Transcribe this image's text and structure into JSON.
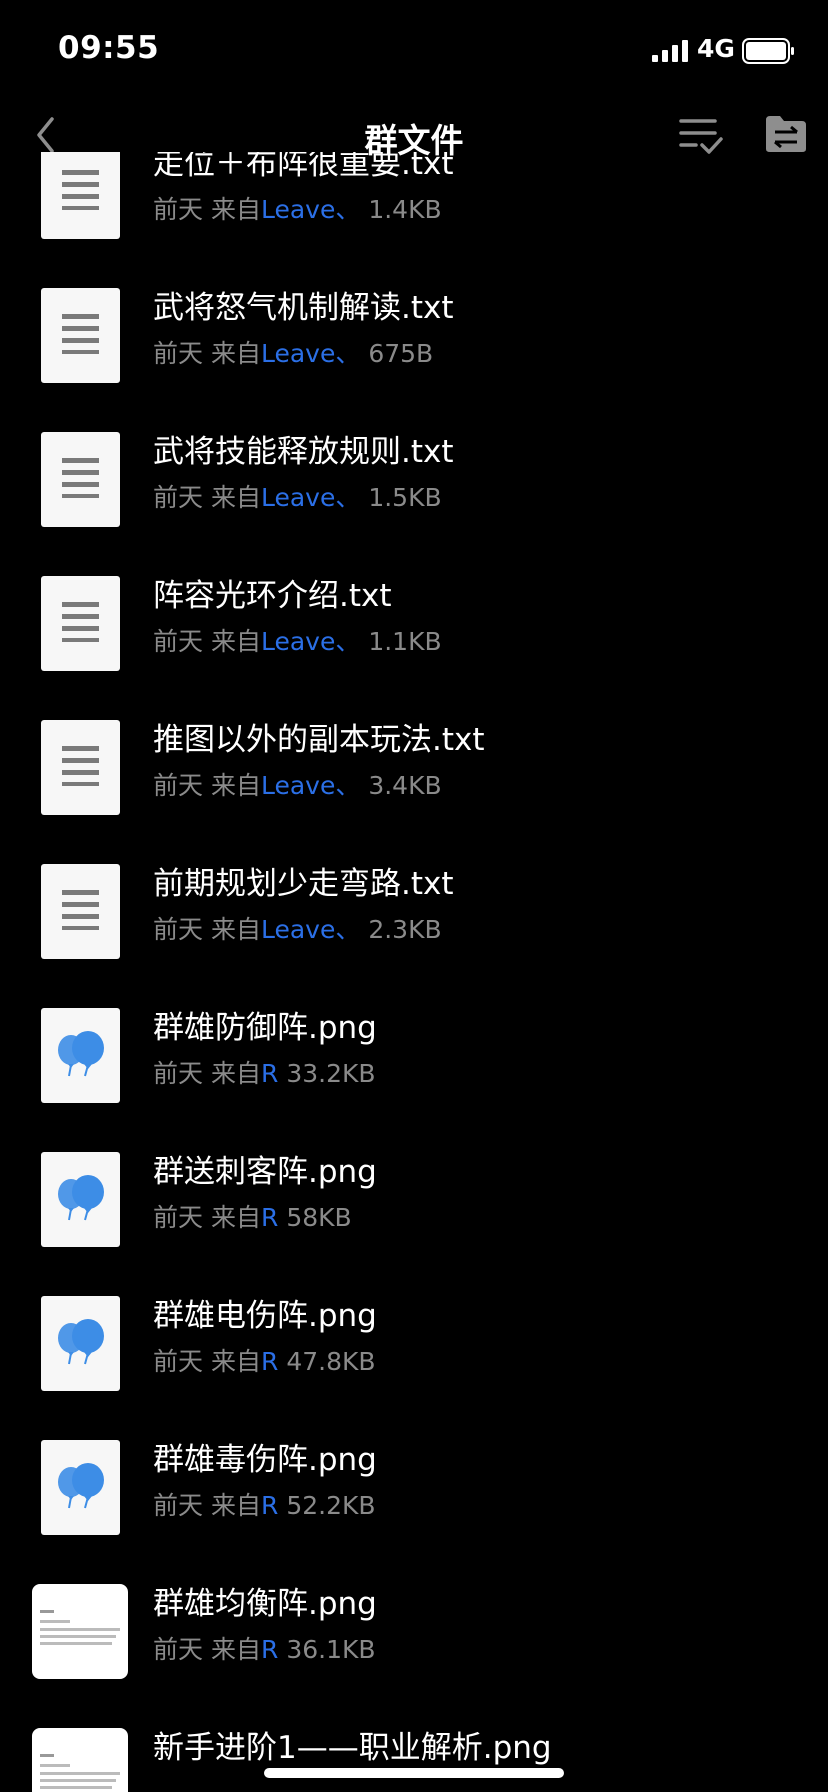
{
  "status_bar": {
    "time": "09:55",
    "network": "4G"
  },
  "nav": {
    "title": "群文件"
  },
  "files": [
    {
      "name": "走位＋布阵很重要.txt",
      "date": "前天",
      "from_label": "来自",
      "sender": "Leave",
      "separator": "、",
      "size": "1.4KB",
      "thumb": "text-file-icon"
    },
    {
      "name": "武将怒气机制解读.txt",
      "date": "前天",
      "from_label": "来自",
      "sender": "Leave",
      "separator": "、",
      "size": "675B",
      "thumb": "text-file-icon"
    },
    {
      "name": "武将技能释放规则.txt",
      "date": "前天",
      "from_label": "来自",
      "sender": "Leave",
      "separator": "、",
      "size": "1.5KB",
      "thumb": "text-file-icon"
    },
    {
      "name": "阵容光环介绍.txt",
      "date": "前天",
      "from_label": "来自",
      "sender": "Leave",
      "separator": "、",
      "size": "1.1KB",
      "thumb": "text-file-icon"
    },
    {
      "name": "推图以外的副本玩法.txt",
      "date": "前天",
      "from_label": "来自",
      "sender": "Leave",
      "separator": "、",
      "size": "3.4KB",
      "thumb": "text-file-icon"
    },
    {
      "name": "前期规划少走弯路.txt",
      "date": "前天",
      "from_label": "来自",
      "sender": "Leave",
      "separator": "、",
      "size": "2.3KB",
      "thumb": "text-file-icon"
    },
    {
      "name": "群雄防御阵.png",
      "date": "前天",
      "from_label": "来自",
      "sender": "R",
      "separator": "",
      "size": "33.2KB",
      "thumb": "image-placeholder-icon"
    },
    {
      "name": "群送刺客阵.png",
      "date": "前天",
      "from_label": "来自",
      "sender": "R",
      "separator": "",
      "size": "58KB",
      "thumb": "image-placeholder-icon"
    },
    {
      "name": "群雄电伤阵.png",
      "date": "前天",
      "from_label": "来自",
      "sender": "R",
      "separator": "",
      "size": "47.8KB",
      "thumb": "image-placeholder-icon"
    },
    {
      "name": "群雄毒伤阵.png",
      "date": "前天",
      "from_label": "来自",
      "sender": "R",
      "separator": "",
      "size": "52.2KB",
      "thumb": "image-placeholder-icon"
    },
    {
      "name": "群雄均衡阵.png",
      "date": "前天",
      "from_label": "来自",
      "sender": "R",
      "separator": "",
      "size": "36.1KB",
      "thumb": "image-preview"
    },
    {
      "name": "新手进阶1——职业解析.png",
      "date": "",
      "from_label": "",
      "sender": "",
      "separator": "",
      "size": "",
      "thumb": "image-preview"
    }
  ],
  "colors": {
    "background": "#000000",
    "sender_link": "#2b6fe6",
    "meta_text": "#8a8a8a",
    "icon_gray": "#7a7a7a",
    "balloon_blue": "#3d8de6"
  }
}
